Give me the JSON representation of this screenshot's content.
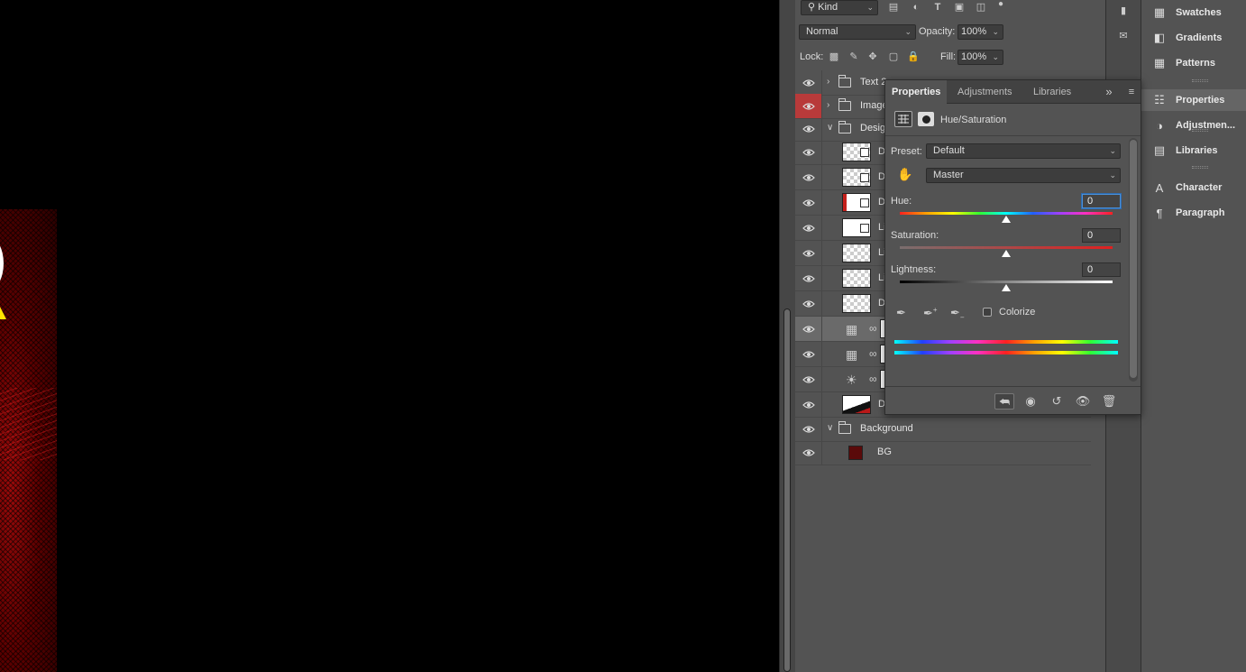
{
  "layers_panel": {
    "filter": {
      "kind_label": "Kind"
    },
    "blend_mode": "Normal",
    "opacity_label": "Opacity:",
    "opacity_value": "100%",
    "lock_label": "Lock:",
    "fill_label": "Fill:",
    "fill_value": "100%",
    "layers": [
      {
        "name": "Text 2",
        "type": "group",
        "expanded": false
      },
      {
        "name": "Image",
        "type": "group",
        "expanded": false,
        "visibility_highlight": "#b83a3a"
      },
      {
        "name": "Desig",
        "type": "group",
        "expanded": true
      },
      {
        "name": "D",
        "type": "smart-object"
      },
      {
        "name": "D",
        "type": "smart-object"
      },
      {
        "name": "D",
        "type": "smart-object"
      },
      {
        "name": "Li",
        "type": "smart-object"
      },
      {
        "name": "Li",
        "type": "pixel"
      },
      {
        "name": "Li",
        "type": "pixel"
      },
      {
        "name": "D",
        "type": "pixel"
      },
      {
        "name": "",
        "type": "adjustment-hue-saturation",
        "selected": true
      },
      {
        "name": "",
        "type": "adjustment-hue-saturation"
      },
      {
        "name": "",
        "type": "adjustment-brightness"
      },
      {
        "name": "D",
        "type": "pixel"
      },
      {
        "name": "Background",
        "type": "group",
        "expanded": true
      },
      {
        "name": "BG",
        "type": "fill",
        "swatch": "#5a0a0a"
      }
    ]
  },
  "properties_panel": {
    "tabs": [
      {
        "label": "Properties",
        "active": true
      },
      {
        "label": "Adjustments",
        "active": false
      },
      {
        "label": "Libraries",
        "active": false
      }
    ],
    "adjustment_title": "Hue/Saturation",
    "preset_label": "Preset:",
    "preset_value": "Default",
    "channel_value": "Master",
    "hue_label": "Hue:",
    "hue_value": "0",
    "saturation_label": "Saturation:",
    "saturation_value": "0",
    "lightness_label": "Lightness:",
    "lightness_value": "0",
    "slider_positions": {
      "hue": 0.5,
      "saturation": 0.5,
      "lightness": 0.5
    },
    "colorize_label": "Colorize",
    "colorize_checked": false
  },
  "dock": {
    "items": [
      {
        "label": "Swatches",
        "icon": "swatches-icon"
      },
      {
        "label": "Gradients",
        "icon": "gradients-icon"
      },
      {
        "label": "Patterns",
        "icon": "patterns-icon"
      },
      {
        "label": "Properties",
        "icon": "properties-icon",
        "active": true
      },
      {
        "label": "Adjustmen...",
        "icon": "adjustments-icon"
      },
      {
        "label": "Libraries",
        "icon": "libraries-icon"
      },
      {
        "label": "Character",
        "icon": "character-icon"
      },
      {
        "label": "Paragraph",
        "icon": "paragraph-icon"
      }
    ]
  },
  "colors": {
    "panel_bg": "#535353",
    "canvas_bg": "#000000",
    "accent_focus": "#4a90d9",
    "visibility_red": "#b83a3a"
  }
}
